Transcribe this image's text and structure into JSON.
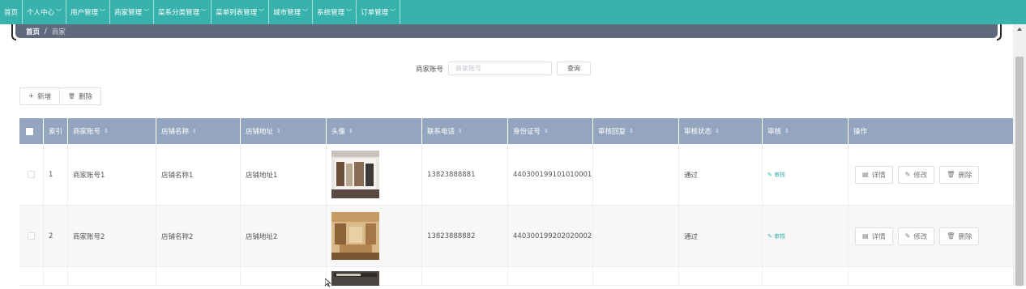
{
  "nav": [
    {
      "label": "首页",
      "chevron": false
    },
    {
      "label": "个人中心",
      "chevron": true
    },
    {
      "label": "用户管理",
      "chevron": true
    },
    {
      "label": "商家管理",
      "chevron": true
    },
    {
      "label": "菜系分类管理",
      "chevron": true
    },
    {
      "label": "菜单列表管理",
      "chevron": true
    },
    {
      "label": "城市管理",
      "chevron": true
    },
    {
      "label": "系统管理",
      "chevron": true
    },
    {
      "label": "订单管理",
      "chevron": true
    }
  ],
  "breadcrumb": {
    "home": "首页",
    "separator": "/",
    "current": "商家"
  },
  "search": {
    "label": "商家账号",
    "placeholder": "商家账号",
    "button": "查询"
  },
  "toolbar": {
    "add": "新增",
    "add_icon": "+",
    "delete": "删除",
    "delete_icon": "🗑"
  },
  "table": {
    "headers": [
      "索引",
      "商家账号",
      "店铺名称",
      "店铺地址",
      "头像",
      "联系电话",
      "身份证号",
      "审核回复",
      "审核状态",
      "审核",
      "操作"
    ],
    "sort_icon": "⇕",
    "rows": [
      {
        "index": "1",
        "account": "商家账号1",
        "shop": "店铺名称1",
        "address": "店铺地址1",
        "phone": "13823888881",
        "idcard": "440300199101010001",
        "reply": "",
        "status": "通过",
        "audit": "审核"
      },
      {
        "index": "2",
        "account": "商家账号2",
        "shop": "店铺名称2",
        "address": "店铺地址2",
        "phone": "13823888882",
        "idcard": "440300199202020002",
        "reply": "",
        "status": "通过",
        "audit": "审核"
      },
      {
        "index": "",
        "account": "",
        "shop": "",
        "address": "",
        "phone": "",
        "idcard": "",
        "reply": "",
        "status": "",
        "audit": ""
      }
    ],
    "ops": {
      "detail": "详情",
      "edit": "修改",
      "delete": "删除"
    }
  },
  "colors": {
    "nav": "#38b2ac",
    "header": "#94a6bf",
    "breadcrumb": "#5f6b7d"
  }
}
